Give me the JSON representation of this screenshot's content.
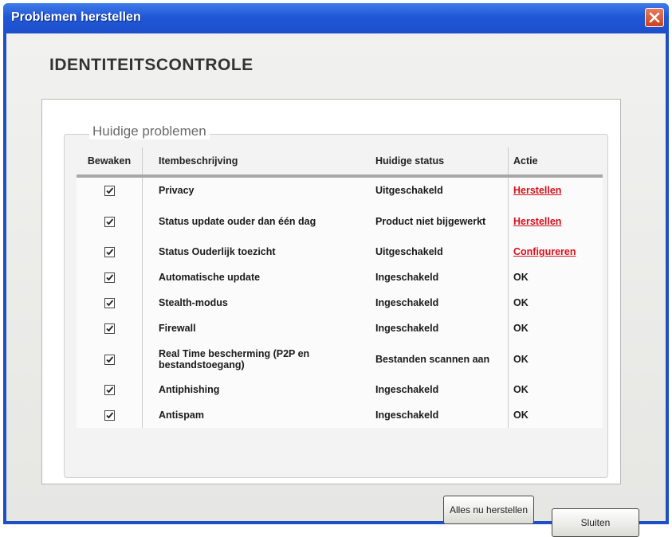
{
  "window": {
    "title": "Problemen herstellen"
  },
  "heading": "IDENTITEITSCONTROLE",
  "group": {
    "label": "Huidige problemen"
  },
  "table": {
    "columns": [
      "Bewaken",
      "Itembeschrijving",
      "Huidige status",
      "Actie"
    ],
    "rows": [
      {
        "monitored": true,
        "item": "Privacy",
        "status": "Uitgeschakeld",
        "action": "Herstellen",
        "action_is_link": true
      },
      {
        "monitored": true,
        "item": "Status update ouder dan één dag",
        "status": "Product niet bijgewerkt",
        "action": "Herstellen",
        "action_is_link": true
      },
      {
        "monitored": true,
        "item": "Status Ouderlijk toezicht",
        "status": "Uitgeschakeld",
        "action": "Configureren",
        "action_is_link": true
      },
      {
        "monitored": true,
        "item": "Automatische update",
        "status": "Ingeschakeld",
        "action": "OK",
        "action_is_link": false
      },
      {
        "monitored": true,
        "item": "Stealth-modus",
        "status": "Ingeschakeld",
        "action": "OK",
        "action_is_link": false
      },
      {
        "monitored": true,
        "item": "Firewall",
        "status": "Ingeschakeld",
        "action": "OK",
        "action_is_link": false
      },
      {
        "monitored": true,
        "item": "Real Time bescherming (P2P en bestandstoegang)",
        "status": "Bestanden scannen aan",
        "action": "OK",
        "action_is_link": false
      },
      {
        "monitored": true,
        "item": "Antiphishing",
        "status": "Ingeschakeld",
        "action": "OK",
        "action_is_link": false
      },
      {
        "monitored": true,
        "item": "Antispam",
        "status": "Ingeschakeld",
        "action": "OK",
        "action_is_link": false
      }
    ]
  },
  "buttons": {
    "fix_all": "Alles nu herstellen",
    "close": "Sluiten"
  },
  "colors": {
    "titlebar": "#2057d6",
    "link": "#d6101a",
    "close_button": "#c9421e"
  },
  "icons": {
    "close": "close-icon",
    "checkbox": "checkmark-icon"
  }
}
